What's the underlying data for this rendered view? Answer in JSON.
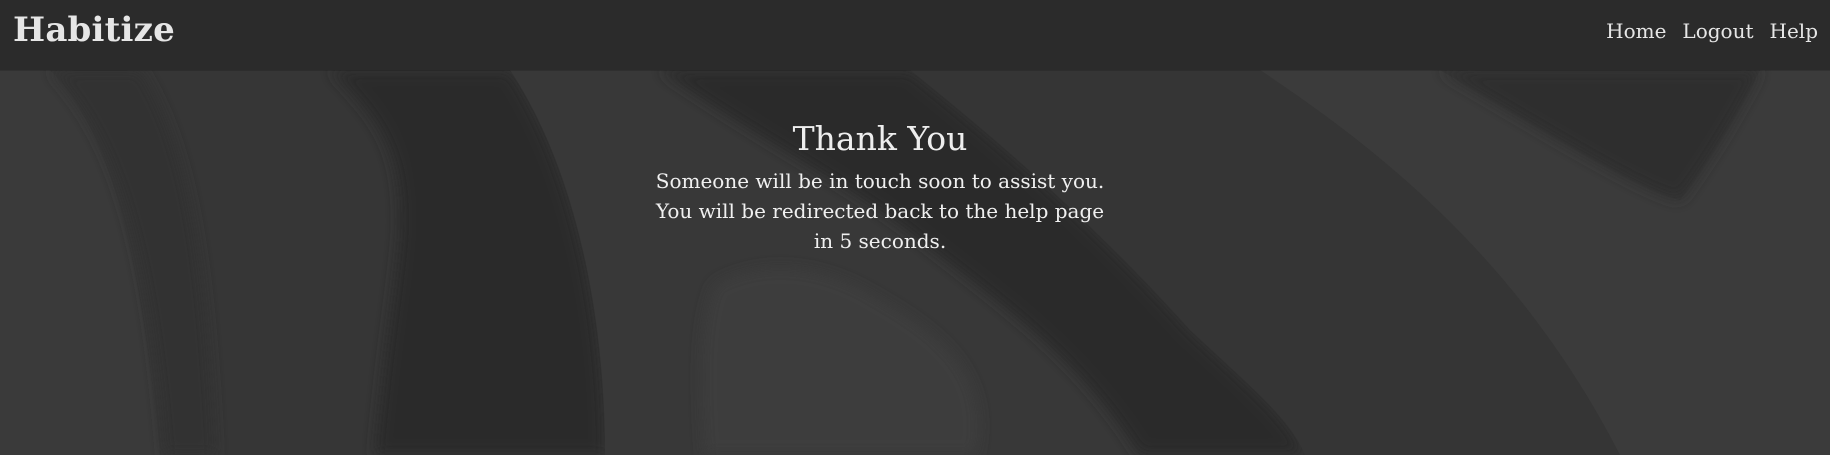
{
  "header": {
    "brand": "Habitize",
    "nav": [
      {
        "label": "Home"
      },
      {
        "label": "Logout"
      },
      {
        "label": "Help"
      }
    ]
  },
  "main": {
    "title": "Thank You",
    "message_line1": "Someone will be in touch soon to assist you.",
    "message_line2": "You will be redirected back to the help page in 5 seconds."
  },
  "colors": {
    "navbar": "#2b2b2b",
    "background": "#333333",
    "text": "#e6e6e6"
  }
}
